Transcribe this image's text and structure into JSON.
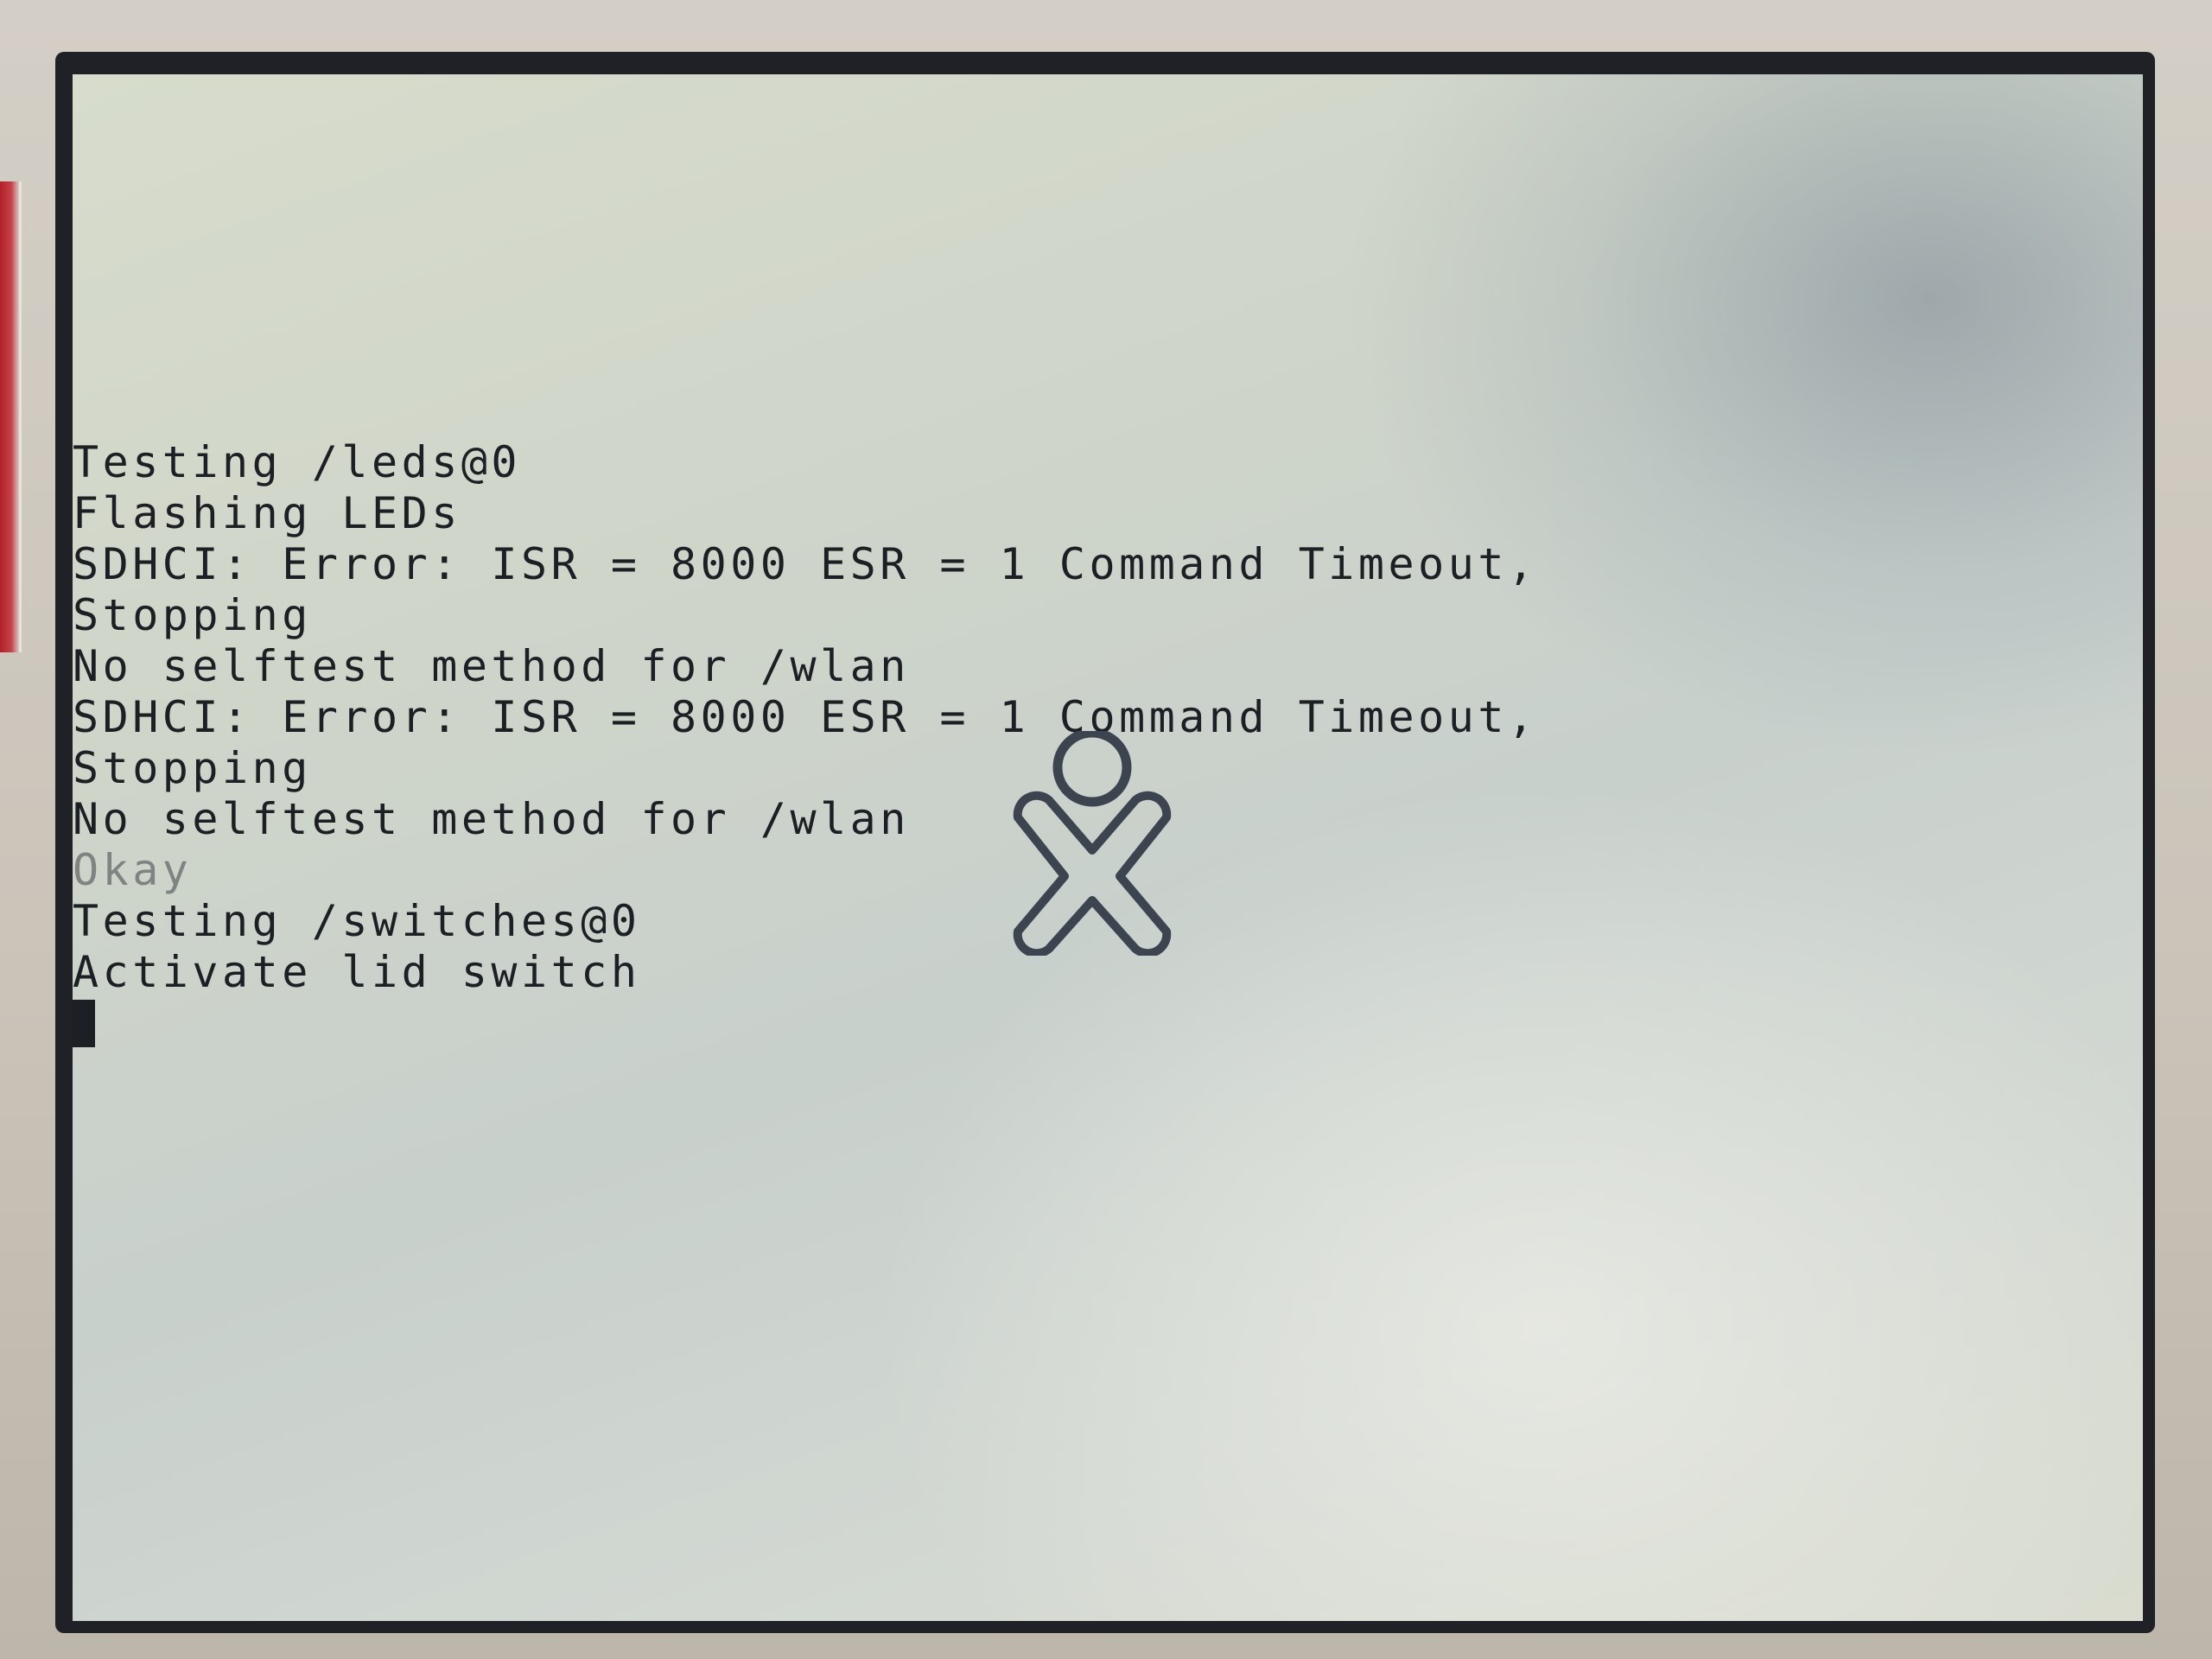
{
  "console": {
    "lines": [
      "Testing /leds@0",
      "Flashing LEDs",
      "SDHCI: Error: ISR = 8000 ESR = 1 Command Timeout,",
      "Stopping",
      "No selftest method for /wlan",
      "SDHCI: Error: ISR = 8000 ESR = 1 Command Timeout,",
      "Stopping",
      "No selftest method for /wlan",
      "Okay",
      "Testing /switches@0",
      "Activate lid switch"
    ]
  },
  "logo": {
    "icon": "xo-logo-icon",
    "stroke_color": "#3c4450"
  },
  "colors": {
    "text": "#1c1f23",
    "dim_text": "#7f8482",
    "cursor": "#1c2024"
  }
}
